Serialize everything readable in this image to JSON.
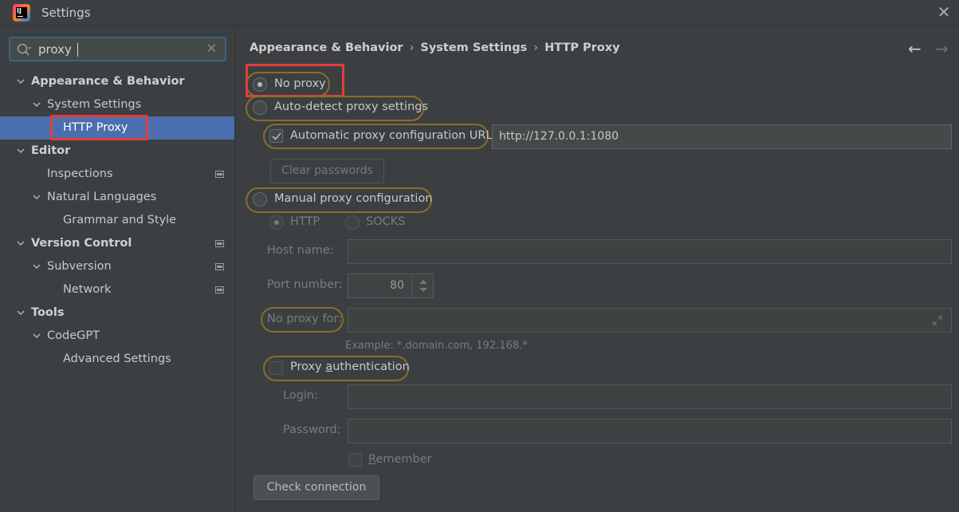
{
  "window": {
    "title": "Settings"
  },
  "search": {
    "value": "proxy"
  },
  "sidebar": {
    "items": [
      {
        "label": "Appearance & Behavior"
      },
      {
        "label": "System Settings"
      },
      {
        "label": "HTTP Proxy"
      },
      {
        "label": "Editor"
      },
      {
        "label": "Inspections"
      },
      {
        "label": "Natural Languages"
      },
      {
        "label": "Grammar and Style"
      },
      {
        "label": "Version Control"
      },
      {
        "label": "Subversion"
      },
      {
        "label": "Network"
      },
      {
        "label": "Tools"
      },
      {
        "label": "CodeGPT"
      },
      {
        "label": "Advanced Settings"
      }
    ]
  },
  "breadcrumb": {
    "parts": [
      "Appearance & Behavior",
      "System Settings",
      "HTTP Proxy"
    ]
  },
  "proxy": {
    "no_proxy_label": "No proxy",
    "auto_detect_label": "Auto-detect proxy settings",
    "auto_config_url_label": "Automatic proxy configuration URL:",
    "auto_config_url_value": "http://127.0.0.1:1080",
    "clear_passwords_label": "Clear passwords",
    "manual_label": "Manual proxy configuration",
    "http_label": "HTTP",
    "socks_label": "SOCKS",
    "host_name_label": "Host name:",
    "port_number_label": "Port number:",
    "port_value": "80",
    "no_proxy_for_label": "No proxy for:",
    "example_text": "Example: *.domain.com, 192.168.*",
    "auth_label_prefix": "Proxy ",
    "auth_label_underlined": "a",
    "auth_label_suffix": "uthentication",
    "login_label": "Login:",
    "password_label": "Password:",
    "remember_underlined": "R",
    "remember_suffix": "emember",
    "check_connection_label": "Check connection"
  },
  "colors": {
    "background": "#3c3f41",
    "selection": "#4b6eaf",
    "highlight_red": "#e53b3b",
    "search_match_outline": "#8a6d2c"
  }
}
